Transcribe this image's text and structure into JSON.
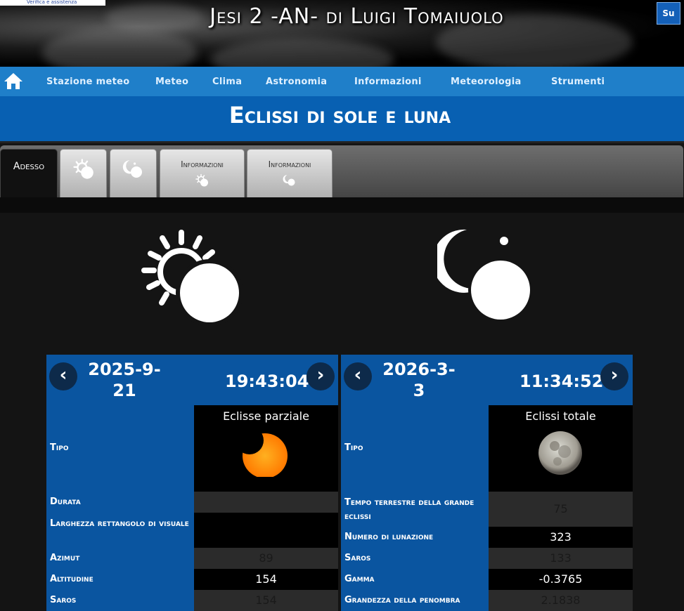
{
  "header": {
    "badge": "Verifica e assistenza",
    "site_title": "Jesi 2 -AN- di Luigi Tomaiuolo",
    "top_button": "Su"
  },
  "nav": {
    "items": [
      "Stazione meteo",
      "Meteo",
      "Clima",
      "Astronomia",
      "Informazioni",
      "Meteorologia",
      "Strumenti"
    ]
  },
  "page": {
    "title": "Eclissi di sole e luna"
  },
  "tabs": {
    "now": "Adesso",
    "info_solar": "Informazioni",
    "info_lunar": "Informazioni"
  },
  "solar": {
    "date": "2025-9-21",
    "time": "19:43:04",
    "type_value": "Eclisse parziale",
    "rows": [
      {
        "label": "Tipo",
        "value": ""
      },
      {
        "label": "Durata",
        "value": ""
      },
      {
        "label": "Larghezza rettangolo di visuale",
        "value": ""
      },
      {
        "label": "Azimut",
        "value": "89"
      },
      {
        "label": "Altitudine",
        "value": "154"
      },
      {
        "label": "Saros",
        "value": "154"
      }
    ]
  },
  "lunar": {
    "date": "2026-3-3",
    "time": "11:34:52",
    "type_value": "Eclissi totale",
    "rows": [
      {
        "label": "Tipo",
        "value": ""
      },
      {
        "label": "Tempo terrestre della grande eclissi",
        "value": "75"
      },
      {
        "label": "Numero di lunazione",
        "value": "323"
      },
      {
        "label": "Saros",
        "value": "133"
      },
      {
        "label": "Gamma",
        "value": "-0.3765"
      },
      {
        "label": "Grandezza della penombra",
        "value": "2.1838"
      }
    ]
  },
  "icons": {
    "home": "home-icon",
    "solar": "solar-eclipse-icon",
    "lunar": "lunar-eclipse-icon",
    "prev": "chevron-left-icon",
    "next": "chevron-right-icon"
  },
  "colors": {
    "nav": "#1f7fc9",
    "title_bar": "#0860b2",
    "panel": "#0a55a0"
  }
}
